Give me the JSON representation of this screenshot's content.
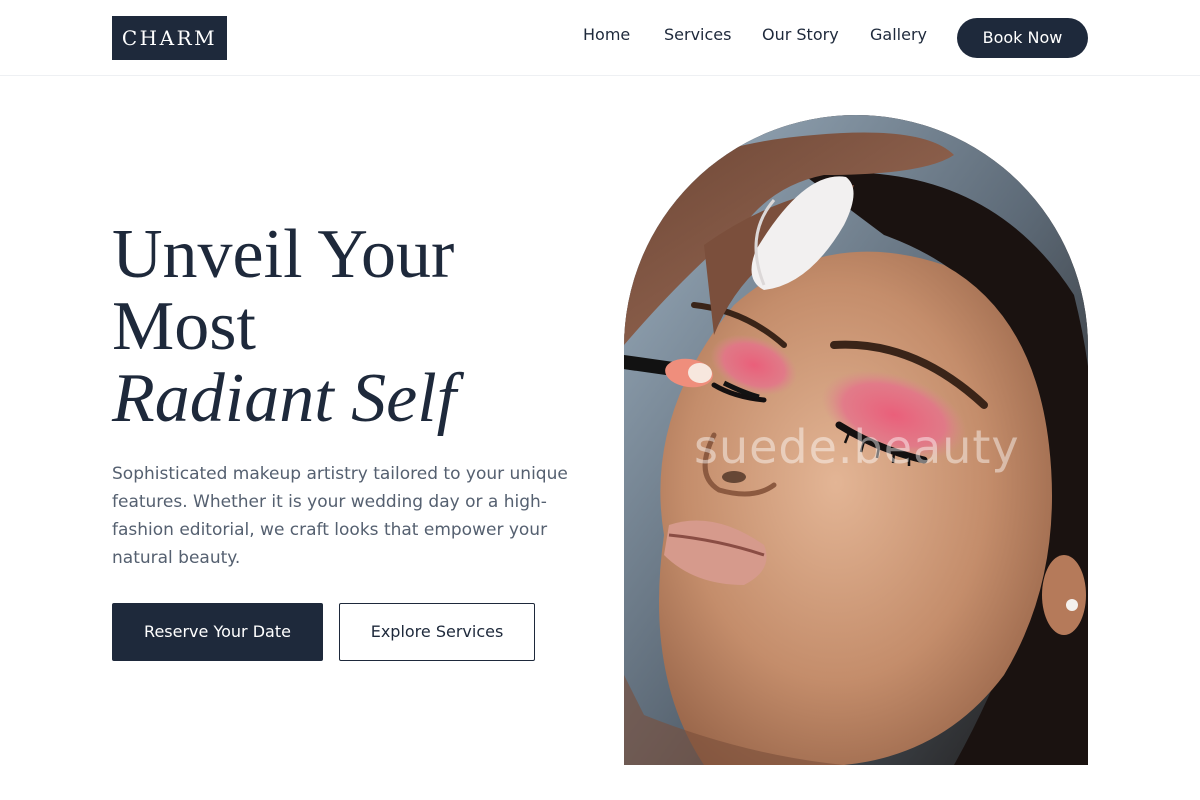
{
  "header": {
    "logo": "CHARM",
    "nav": {
      "home": "Home",
      "services": "Services",
      "story": "Our Story",
      "gallery": "Gallery"
    },
    "cta": "Book Now"
  },
  "hero": {
    "title_line1": "Unveil Your",
    "title_line2": "Most",
    "title_line3": "Radiant Self",
    "description": "Sophisticated makeup artistry tailored to your unique features. Whether it is your wedding day or a high-fashion editorial, we craft looks that empower your natural beauty.",
    "primary_button": "Reserve Your Date",
    "secondary_button": "Explore Services",
    "image_watermark": "suede.beauty",
    "image_alt": "Makeup artist applying pink eyeshadow to a model"
  },
  "colors": {
    "navy": "#1e293b",
    "body_text": "#556070",
    "eyeshadow": "#e5617a"
  }
}
